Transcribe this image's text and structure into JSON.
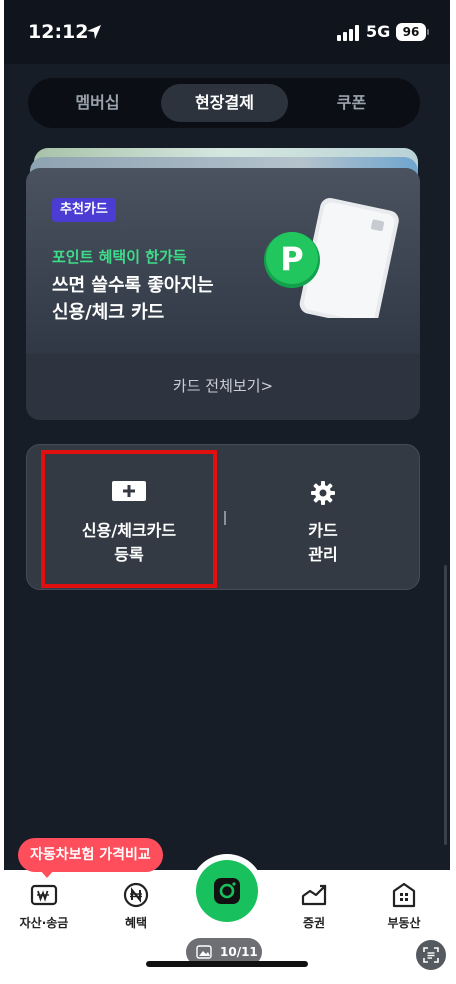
{
  "status_bar": {
    "time": "12:12",
    "network": "5G",
    "battery": "96",
    "icons": [
      "location-arrow-icon",
      "signal-icon"
    ]
  },
  "tabs": [
    {
      "label": "멤버십",
      "active": false
    },
    {
      "label": "현장결제",
      "active": true
    },
    {
      "label": "쿠폰",
      "active": false
    }
  ],
  "promo_card": {
    "badge": "추천카드",
    "subtitle": "포인트 혜택이 한가득",
    "headline_line1": "쓰면 쓸수록 좋아지는",
    "headline_line2": "신용/체크 카드",
    "footer_link": "카드 전체보기>",
    "illustration_letter": "P"
  },
  "actions": {
    "register": {
      "line1": "신용/체크카드",
      "line2": "등록",
      "icon": "card-add-icon"
    },
    "manage": {
      "line1": "카드",
      "line2": "관리",
      "icon": "gear-icon"
    }
  },
  "floating_promo": "자동차보험 가격비교",
  "bottom_nav": [
    {
      "label": "자산·송금",
      "icon": "won-wallet-icon"
    },
    {
      "label": "혜택",
      "icon": "naira-coin-icon"
    },
    {
      "label": "증권",
      "icon": "stock-chart-icon"
    },
    {
      "label": "부동산",
      "icon": "building-icon"
    }
  ],
  "center_button": {
    "icon": "pay-camera-icon"
  },
  "page_indicator": "10/11",
  "colors": {
    "background": "#171d27",
    "accent_green": "#19c15e",
    "badge_purple": "#4b3cd4",
    "highlight_red": "#e01010",
    "promo_red": "#ff4e5b"
  }
}
